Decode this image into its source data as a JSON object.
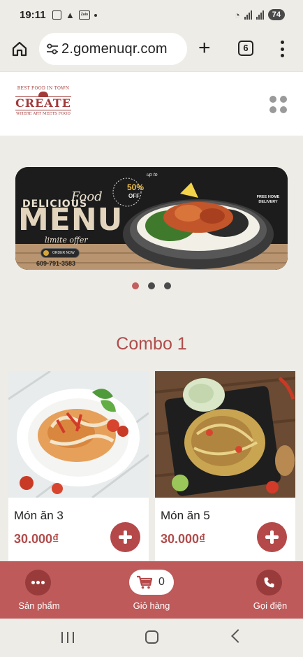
{
  "status_bar": {
    "time": "19:11",
    "battery": "74",
    "app_icon_label": "Zalo"
  },
  "browser": {
    "url": "2.gomenuqr.com",
    "tab_count": "6"
  },
  "site_header": {
    "logo": {
      "top": "BEST FOOD IN TOWN",
      "main": "CREATE",
      "bottom": "WHERE ART MEETS FOOD"
    }
  },
  "banner": {
    "delicious": "DELICIOUS",
    "food": "Food",
    "menu": "MENU",
    "limited": "limite offer",
    "order_now": "ORDER NOW",
    "phone": "609-791-3583",
    "up_to": "up to",
    "discount": "50%",
    "off": "OFF",
    "free_delivery": "FREE HOME DELIVERY"
  },
  "carousel": {
    "slide_count": 3,
    "active_index": 0
  },
  "section": {
    "title": "Combo 1"
  },
  "products": [
    {
      "name": "Món ăn 3",
      "price": "30.000₫"
    },
    {
      "name": "Món ăn 5",
      "price": "30.000₫"
    }
  ],
  "bottom_nav": {
    "products_label": "Sản phẩm",
    "cart_label": "Giỏ hàng",
    "cart_count": "0",
    "call_label": "Gọi điện"
  },
  "colors": {
    "accent": "#b04c4c",
    "bottom_bar": "#be5a5a",
    "page_bg": "#edece7"
  },
  "icons": {
    "home": "home-icon",
    "site_settings": "tune-icon",
    "new_tab": "plus-icon",
    "tabs": "tab-switcher-icon",
    "browser_menu": "more-vertical-icon",
    "site_menu": "grid-icon",
    "products": "more-horizontal-icon",
    "cart": "cart-icon",
    "call": "phone-icon"
  }
}
